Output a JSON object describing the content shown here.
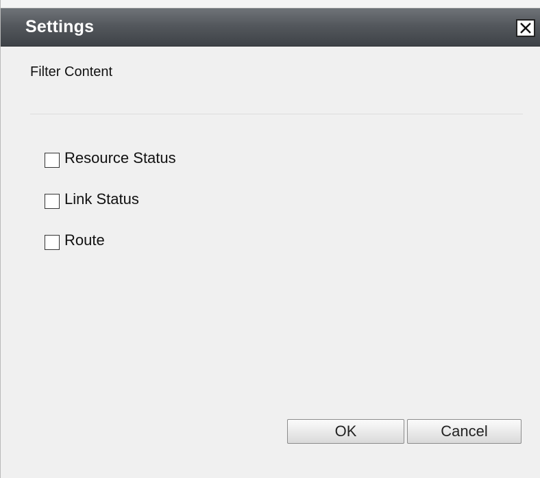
{
  "dialog": {
    "title": "Settings",
    "close_icon": "close-icon"
  },
  "filter": {
    "section_label": "Filter Content",
    "options": [
      {
        "label": "Resource Status",
        "checked": false
      },
      {
        "label": "Link Status",
        "checked": false
      },
      {
        "label": "Route",
        "checked": false
      }
    ]
  },
  "footer": {
    "ok_label": "OK",
    "cancel_label": "Cancel"
  }
}
